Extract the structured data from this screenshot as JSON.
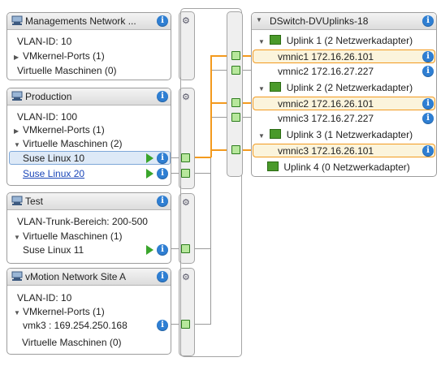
{
  "portgroups": [
    {
      "title": "Managements Network ...",
      "vlan": "VLAN-ID: 10",
      "vmkernel": "VMkernel-Ports (1)",
      "vms": "Virtuelle Maschinen (0)"
    },
    {
      "title": "Production",
      "vlan": "VLAN-ID: 100",
      "vmkernel": "VMkernel-Ports (1)",
      "vms": "Virtuelle Maschinen (2)",
      "vm_items": [
        "Suse Linux 10",
        "Suse Linux 20"
      ]
    },
    {
      "title": "Test",
      "vlan": "VLAN-Trunk-Bereich: 200-500",
      "vms": "Virtuelle Maschinen (1)",
      "vm_items": [
        "Suse Linux 11"
      ]
    },
    {
      "title": "vMotion Network Site A",
      "vlan": "VLAN-ID: 10",
      "vmkernel": "VMkernel-Ports (1)",
      "vmk": "vmk3 : 169.254.250.168",
      "vms": "Virtuelle Maschinen (0)"
    }
  ],
  "uplinks": {
    "title": "DSwitch-DVUplinks-18",
    "groups": [
      {
        "label": "Uplink 1 (2 Netzwerkadapter)",
        "nics": [
          "vmnic1 172.16.26.101",
          "vmnic2 172.16.27.227"
        ]
      },
      {
        "label": "Uplink 2 (2 Netzwerkadapter)",
        "nics": [
          "vmnic2 172.16.26.101",
          "vmnic3 172.16.27.227"
        ]
      },
      {
        "label": "Uplink 3 (1 Netzwerkadapter)",
        "nics": [
          "vmnic3 172.16.26.101"
        ]
      },
      {
        "label": "Uplink 4 (0 Netzwerkadapter)",
        "nics": []
      }
    ]
  },
  "icons": {
    "info": "i",
    "expand": "▶",
    "collapse": "▼"
  },
  "colors": {
    "highlight_orange": "#f39a1e",
    "port_green": "#b7e79c",
    "info_blue": "#2f7fd3",
    "selection_blue": "#dde9f7"
  }
}
